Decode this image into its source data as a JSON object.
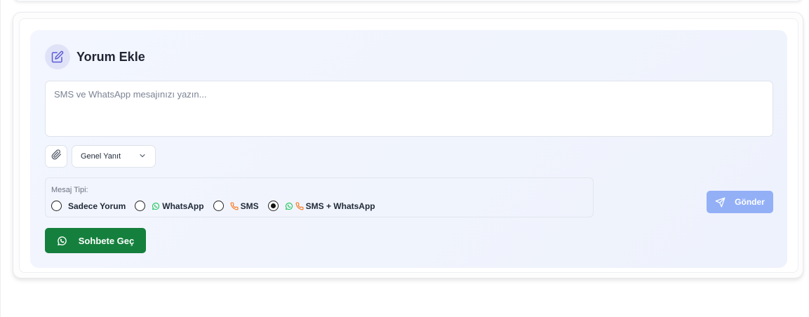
{
  "section": {
    "title": "Yorum Ekle",
    "icon": "edit-icon"
  },
  "composer": {
    "placeholder": "SMS ve WhatsApp mesajınızı yazın...",
    "value": ""
  },
  "toolbar": {
    "attach_icon": "paperclip-icon",
    "template_select": "Genel Yanıt"
  },
  "message_type": {
    "title": "Mesaj Tipi:",
    "options": [
      {
        "label": "Sadece Yorum",
        "checked": false,
        "icons": []
      },
      {
        "label": "WhatsApp",
        "checked": false,
        "icons": [
          "whatsapp-icon"
        ]
      },
      {
        "label": "SMS",
        "checked": false,
        "icons": [
          "phone-icon"
        ]
      },
      {
        "label": "SMS + WhatsApp",
        "checked": true,
        "icons": [
          "whatsapp-icon",
          "phone-icon"
        ]
      }
    ]
  },
  "actions": {
    "send_label": "Gönder",
    "chat_label": "Sohbete Geç"
  },
  "colors": {
    "accent": "#5b5bd6",
    "whatsapp": "#22c55e",
    "sms": "#f97316",
    "send_disabled": "#93b0f7",
    "chat_button": "#15803d"
  }
}
